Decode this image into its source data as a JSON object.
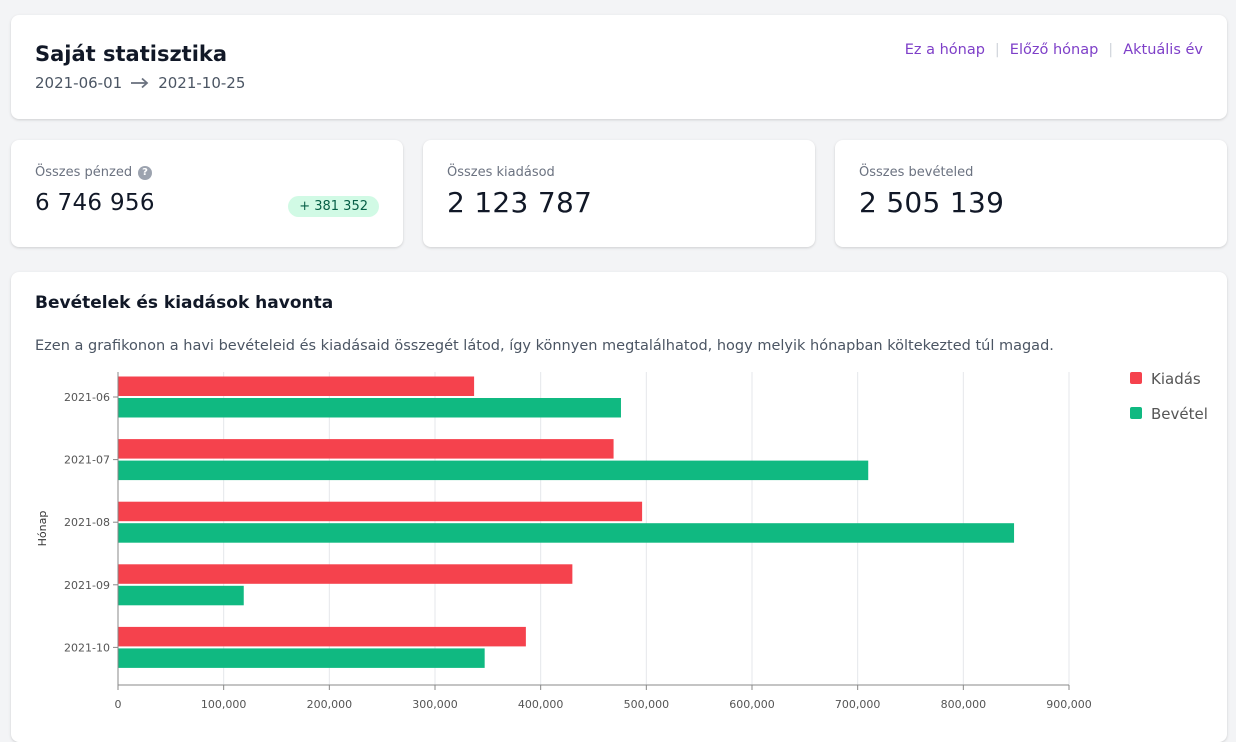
{
  "header": {
    "title": "Saját statisztika",
    "date_from": "2021-06-01",
    "date_to": "2021-10-25",
    "nav": [
      "Ez a hónap",
      "Előző hónap",
      "Aktuális év"
    ]
  },
  "stats": {
    "total": {
      "label": "Összes pénzed",
      "value": "6 746 956",
      "delta": "+ 381 352"
    },
    "expense": {
      "label": "Összes kiadásod",
      "value": "2 123 787"
    },
    "income": {
      "label": "Összes bevételed",
      "value": "2 505 139"
    }
  },
  "chart_section": {
    "title": "Bevételek és kiadások havonta",
    "description": "Ezen a grafikonon a havi bevételeid és kiadásaid összegét látod, így könnyen megtalálhatod, hogy melyik hónapban költekezted túl magad."
  },
  "colors": {
    "expense": "#f5424d",
    "income": "#10b981",
    "accent": "#7e3fc8"
  },
  "chart_data": {
    "type": "bar",
    "orientation": "horizontal",
    "categories": [
      "2021-06",
      "2021-07",
      "2021-08",
      "2021-09",
      "2021-10"
    ],
    "series": [
      {
        "name": "Kiadás",
        "values": [
          337000,
          469000,
          496000,
          430000,
          386000
        ]
      },
      {
        "name": "Bevétel",
        "values": [
          476000,
          710000,
          848000,
          119000,
          347000
        ]
      }
    ],
    "ylabel": "Hónap",
    "xlim": [
      0,
      900000
    ],
    "x_ticks": [
      "0",
      "100,000",
      "200,000",
      "300,000",
      "400,000",
      "500,000",
      "600,000",
      "700,000",
      "800,000",
      "900,000"
    ],
    "grid": true,
    "legend": "top-right"
  }
}
